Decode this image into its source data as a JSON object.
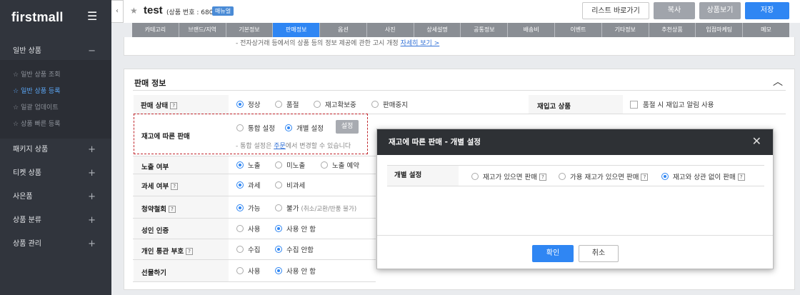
{
  "sidebar": {
    "logo": "firstmall",
    "sections": [
      {
        "label": "일반 상품",
        "toggle": "−"
      },
      {
        "label": "패키지 상품",
        "toggle": "+"
      },
      {
        "label": "티켓 상품",
        "toggle": "+"
      },
      {
        "label": "사은품",
        "toggle": "+"
      },
      {
        "label": "상품 분류",
        "toggle": "+"
      },
      {
        "label": "상품 관리",
        "toggle": "+"
      }
    ],
    "subitems": [
      {
        "label": "일반 상품 조회"
      },
      {
        "label": "일반 상품 등록"
      },
      {
        "label": "일괄 업데이트"
      },
      {
        "label": "상품 빠른 등록"
      }
    ]
  },
  "header": {
    "title": "test",
    "product_no": "(상품 번호 : 680)",
    "manual_badge": "매뉴얼",
    "list_btn": "리스트 바로가기",
    "copy_btn": "복사",
    "view_btn": "상품보기",
    "save_btn": "저장"
  },
  "tabs": [
    "카테고리",
    "브랜드/지역",
    "기본정보",
    "판매정보",
    "옵션",
    "사진",
    "상세설명",
    "공통정보",
    "배송비",
    "이벤트",
    "기타정보",
    "추천상품",
    "입점마케팅",
    "메모"
  ],
  "notice": {
    "text": "- 전자상거래 등에서의 상품 등의 정보 제공에 관한 고시 개정 ",
    "link": "자세히 보기 >"
  },
  "sales_info": {
    "title": "판매 정보",
    "sale_status": {
      "label": "판매 상태",
      "options": [
        "정상",
        "품절",
        "재고확보중",
        "판매중지"
      ]
    },
    "restock": {
      "label": "재입고 상품",
      "checkbox": "품절 시 재입고 알림 사용"
    },
    "stock_sale": {
      "label": "재고에 따른 판매",
      "options": [
        "통합 설정",
        "개별 설정"
      ],
      "setting_btn": "설정",
      "note_prefix": "- 통합 설정은 ",
      "note_link": "주문",
      "note_suffix": "에서 변경할 수 있습니다"
    },
    "exposure": {
      "label": "노출 여부",
      "options": [
        "노출",
        "미노출",
        "노출 예약"
      ]
    },
    "tax": {
      "label": "과세 여부",
      "options": [
        "과세",
        "비과세"
      ]
    },
    "withdraw": {
      "label": "청약철회",
      "options": [
        "가능",
        "불가"
      ],
      "note": "(취소/교환/반품 불가)"
    },
    "adult": {
      "label": "성인 인증",
      "options": [
        "사용",
        "사용 안 함"
      ]
    },
    "customs": {
      "label": "개인 통관 부호",
      "options": [
        "수집",
        "수집 안함"
      ]
    },
    "gift": {
      "label": "선물하기",
      "options": [
        "사용",
        "사용 안 함"
      ]
    }
  },
  "modal": {
    "title": "재고에 따른 판매 - 개별 설정",
    "row_label": "개별 설정",
    "options": [
      "재고가 있으면 판매",
      "가용 재고가 있으면 판매",
      "재고와 상관 없이 판매"
    ],
    "ok_btn": "확인",
    "cancel_btn": "취소"
  }
}
